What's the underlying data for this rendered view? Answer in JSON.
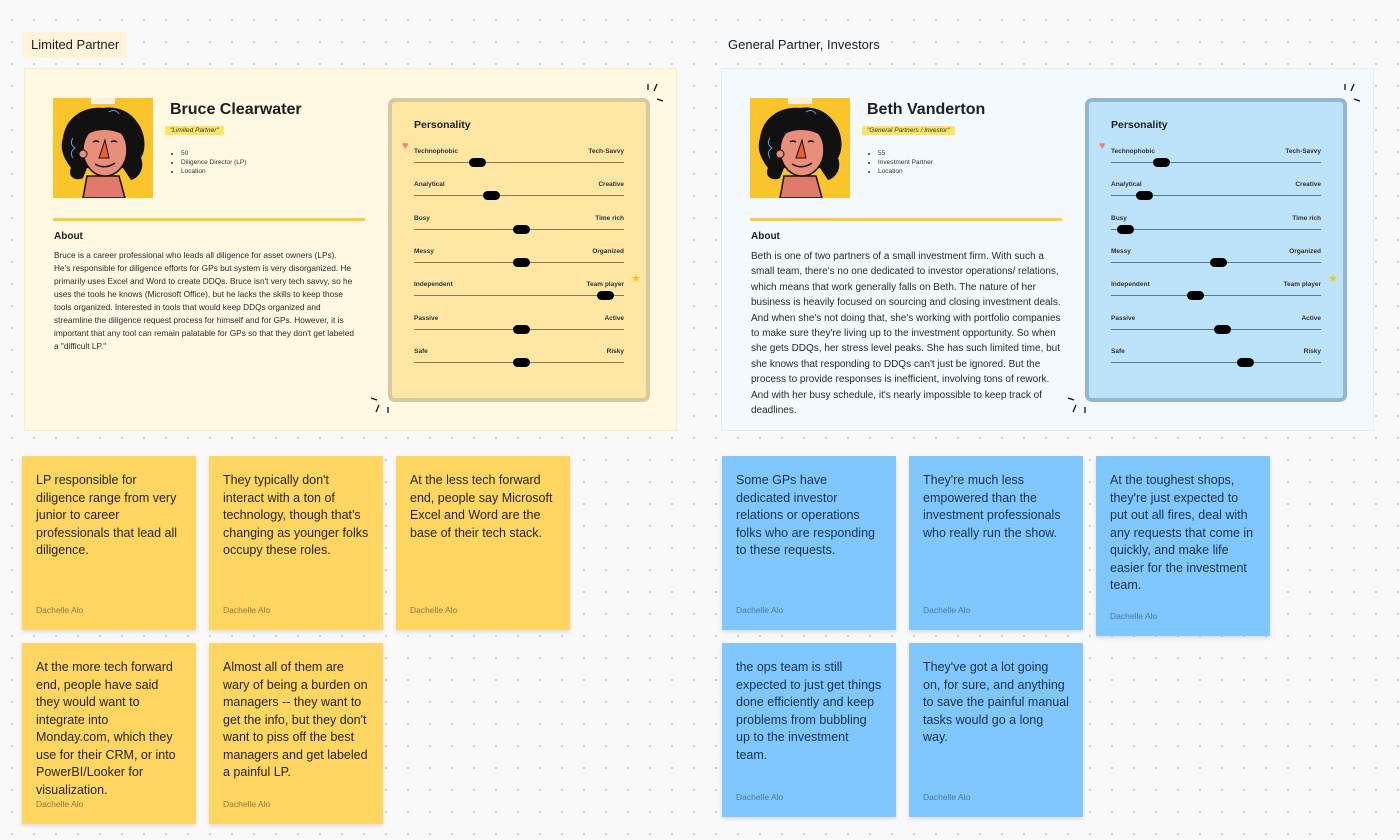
{
  "sections": [
    {
      "label": "Limited Partner",
      "persona": {
        "name": "Bruce Clearwater",
        "role_tag": "\"Limited Partner\"",
        "facts": [
          "50",
          "Diligence Director (LP)",
          "Location"
        ],
        "about_title": "About",
        "about_text": "Bruce is a career professional who leads all diligence for asset owners (LPs). He's responsible for diligence efforts for GPs but system is very disorganized. He primarily uses Excel and Word to create DDQs. Bruce isn't very tech savvy, so he uses the tools he knows (Microsoft Office), but he lacks the skills to keep those tools organized. Interested in tools that would keep DDQs organized and streamline the diligence request process for himself and for GPs. However, it is important that any tool can remain palatable for GPs so that they don't get labeled a \"difficult LP.\"",
        "personality_title": "Personality",
        "traits": [
          {
            "left": "Technophobic",
            "right": "Tech-Savvy",
            "value": 0.3
          },
          {
            "left": "Analytical",
            "right": "Creative",
            "value": 0.37
          },
          {
            "left": "Busy",
            "right": "Time rich",
            "value": 0.51
          },
          {
            "left": "Messy",
            "right": "Organized",
            "value": 0.51
          },
          {
            "left": "Independent",
            "right": "Team player",
            "value": 0.91
          },
          {
            "left": "Passive",
            "right": "Active",
            "value": 0.51
          },
          {
            "left": "Safe",
            "right": "Risky",
            "value": 0.51
          }
        ]
      },
      "notes": [
        {
          "text": "LP responsible for diligence range from very junior to career professionals that lead all diligence.",
          "author": "Dachelle Alo"
        },
        {
          "text": "They typically don't interact with a ton of technology, though that's changing as younger folks occupy these roles.",
          "author": "Dachelle Alo"
        },
        {
          "text": "At the less tech forward end, people say Microsoft Excel and Word are the base of their tech stack.",
          "author": "Dachelle Alo"
        },
        {
          "text": "At the more tech forward end, people have said they would want to integrate into Monday.com, which they use for their CRM, or into PowerBI/Looker for visualization.",
          "author": "Dachelle Alo"
        },
        {
          "text": "Almost all of them are wary of being a burden on managers -- they want to get the info, but they don't want to piss off the best managers and get labeled a painful LP.",
          "author": "Dachelle Alo"
        }
      ]
    },
    {
      "label": "General Partner, Investors",
      "persona": {
        "name": "Beth Vanderton",
        "role_tag": "\"General Partners / Investor\"",
        "facts": [
          "55",
          "Investment Partner",
          "Location"
        ],
        "about_title": "About",
        "about_text": "Beth is one of two partners of a small investment firm. With such a small team, there's no one dedicated to investor operations/ relations, which means that work generally falls on Beth. The nature of her business is heavily focused on sourcing and closing investment deals. And when she's not doing that, she's working with portfolio companies to make sure they're living up to the investment opportunity. So when she gets DDQs, her stress level peaks. She has such limited time, but she knows that responding to DDQs can't just be ignored. But the process to provide responses is inefficient, involving tons of rework. And with her busy schedule, it's nearly impossible to keep track of deadlines.",
        "personality_title": "Personality",
        "traits": [
          {
            "left": "Technophobic",
            "right": "Tech-Savvy",
            "value": 0.24
          },
          {
            "left": "Analytical",
            "right": "Creative",
            "value": 0.16
          },
          {
            "left": "Busy",
            "right": "Time rich",
            "value": 0.07
          },
          {
            "left": "Messy",
            "right": "Organized",
            "value": 0.51
          },
          {
            "left": "Independent",
            "right": "Team player",
            "value": 0.4
          },
          {
            "left": "Passive",
            "right": "Active",
            "value": 0.53
          },
          {
            "left": "Safe",
            "right": "Risky",
            "value": 0.64
          }
        ]
      },
      "notes": [
        {
          "text": "Some GPs have dedicated investor relations or operations folks who are responding to these requests.",
          "author": "Dachelle Alo"
        },
        {
          "text": "They're much less empowered than the investment professionals who really run the show.",
          "author": "Dachelle Alo"
        },
        {
          "text": "At the toughest shops, they're just expected to put out all fires, deal with any requests that come in quickly, and make life easier for the investment team.",
          "author": "Dachelle Alo"
        },
        {
          "text": "the ops team is still expected to just get things done efficiently and keep problems from bubbling up to the investment team.",
          "author": "Dachelle Alo"
        },
        {
          "text": "They've got a lot going on, for sure, and anything to save the painful manual tasks would go a long way.",
          "author": "Dachelle Alo"
        }
      ]
    }
  ],
  "icons": {
    "heart": "♥",
    "star": "★"
  },
  "colors": {
    "lp_frame": "#fff8e3",
    "gp_frame": "#f4f9fd",
    "lp_card": "#ffe7a3",
    "gp_card": "#bde3fb",
    "yellow_note": "#ffd661",
    "blue_note": "#80c7ff",
    "avatar_bg": "#f9c52a",
    "highlight": "#fbe568"
  }
}
